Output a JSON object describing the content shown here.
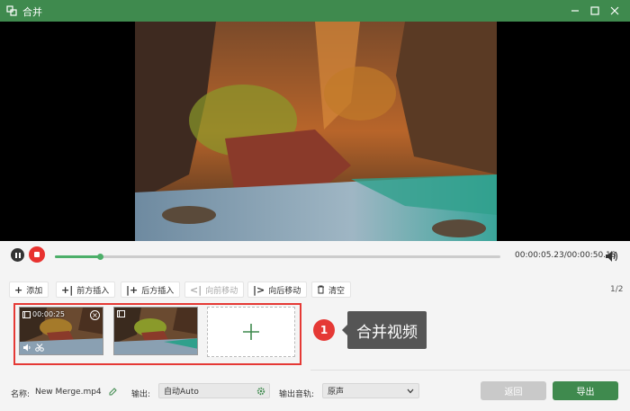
{
  "window": {
    "title": "合并",
    "accent": "#3f8a4e",
    "icons": [
      "merge-app-icon",
      "minimize-icon",
      "maximize-icon",
      "close-icon"
    ]
  },
  "player": {
    "current_time": "00:00:05.23",
    "total_time": "00:00:50.18",
    "timecode": "00:00:05.23/00:00:50.18",
    "progress_fraction": 0.1
  },
  "toolbar": {
    "add": "添加",
    "insert_before": "前方插入",
    "insert_after": "后方插入",
    "move_forward": "向前移动",
    "move_backward": "向后移动",
    "clear": "清空",
    "page": "1/2"
  },
  "clips": [
    {
      "duration": "00:00:25",
      "selected": true
    },
    {
      "duration": "",
      "selected": false
    }
  ],
  "annotation": {
    "step": "1",
    "label": "合并视频"
  },
  "footer": {
    "name_label": "名称:",
    "file_name": "New Merge.mp4",
    "output_label": "输出:",
    "output_value": "自动Auto",
    "audio_label": "输出音轨:",
    "audio_value": "原声",
    "back": "返回",
    "export": "导出"
  }
}
